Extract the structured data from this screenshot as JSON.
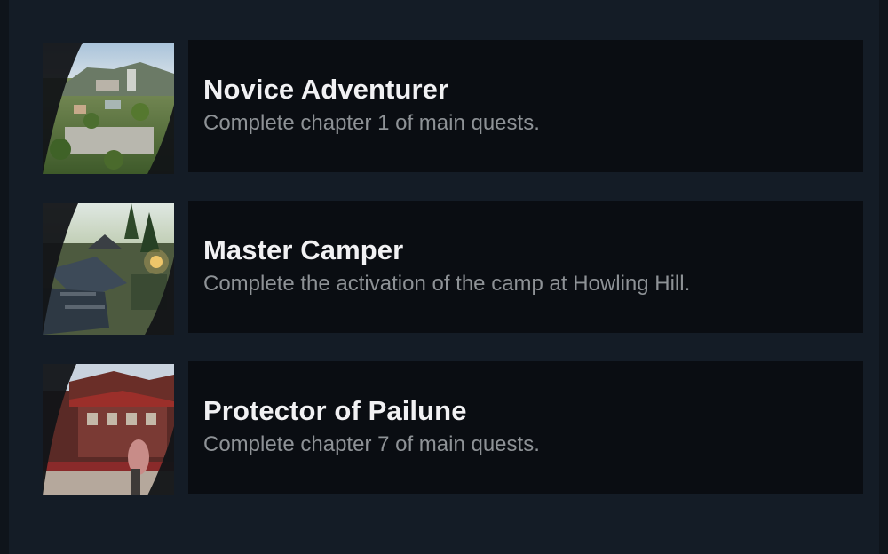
{
  "achievements": [
    {
      "title": "Novice Adventurer",
      "description": "Complete chapter 1 of main quests.",
      "image_icon": "hilltop-town-image"
    },
    {
      "title": "Master Camper",
      "description": "Complete the activation of the camp at Howling Hill.",
      "image_icon": "forest-camp-image"
    },
    {
      "title": "Protector of Pailune",
      "description": "Complete chapter 7 of main quests.",
      "image_icon": "red-temple-image"
    }
  ],
  "colors": {
    "background": "#141c26",
    "card": "#0a0d12",
    "title": "#f1f1f3",
    "description": "#8e9296"
  }
}
